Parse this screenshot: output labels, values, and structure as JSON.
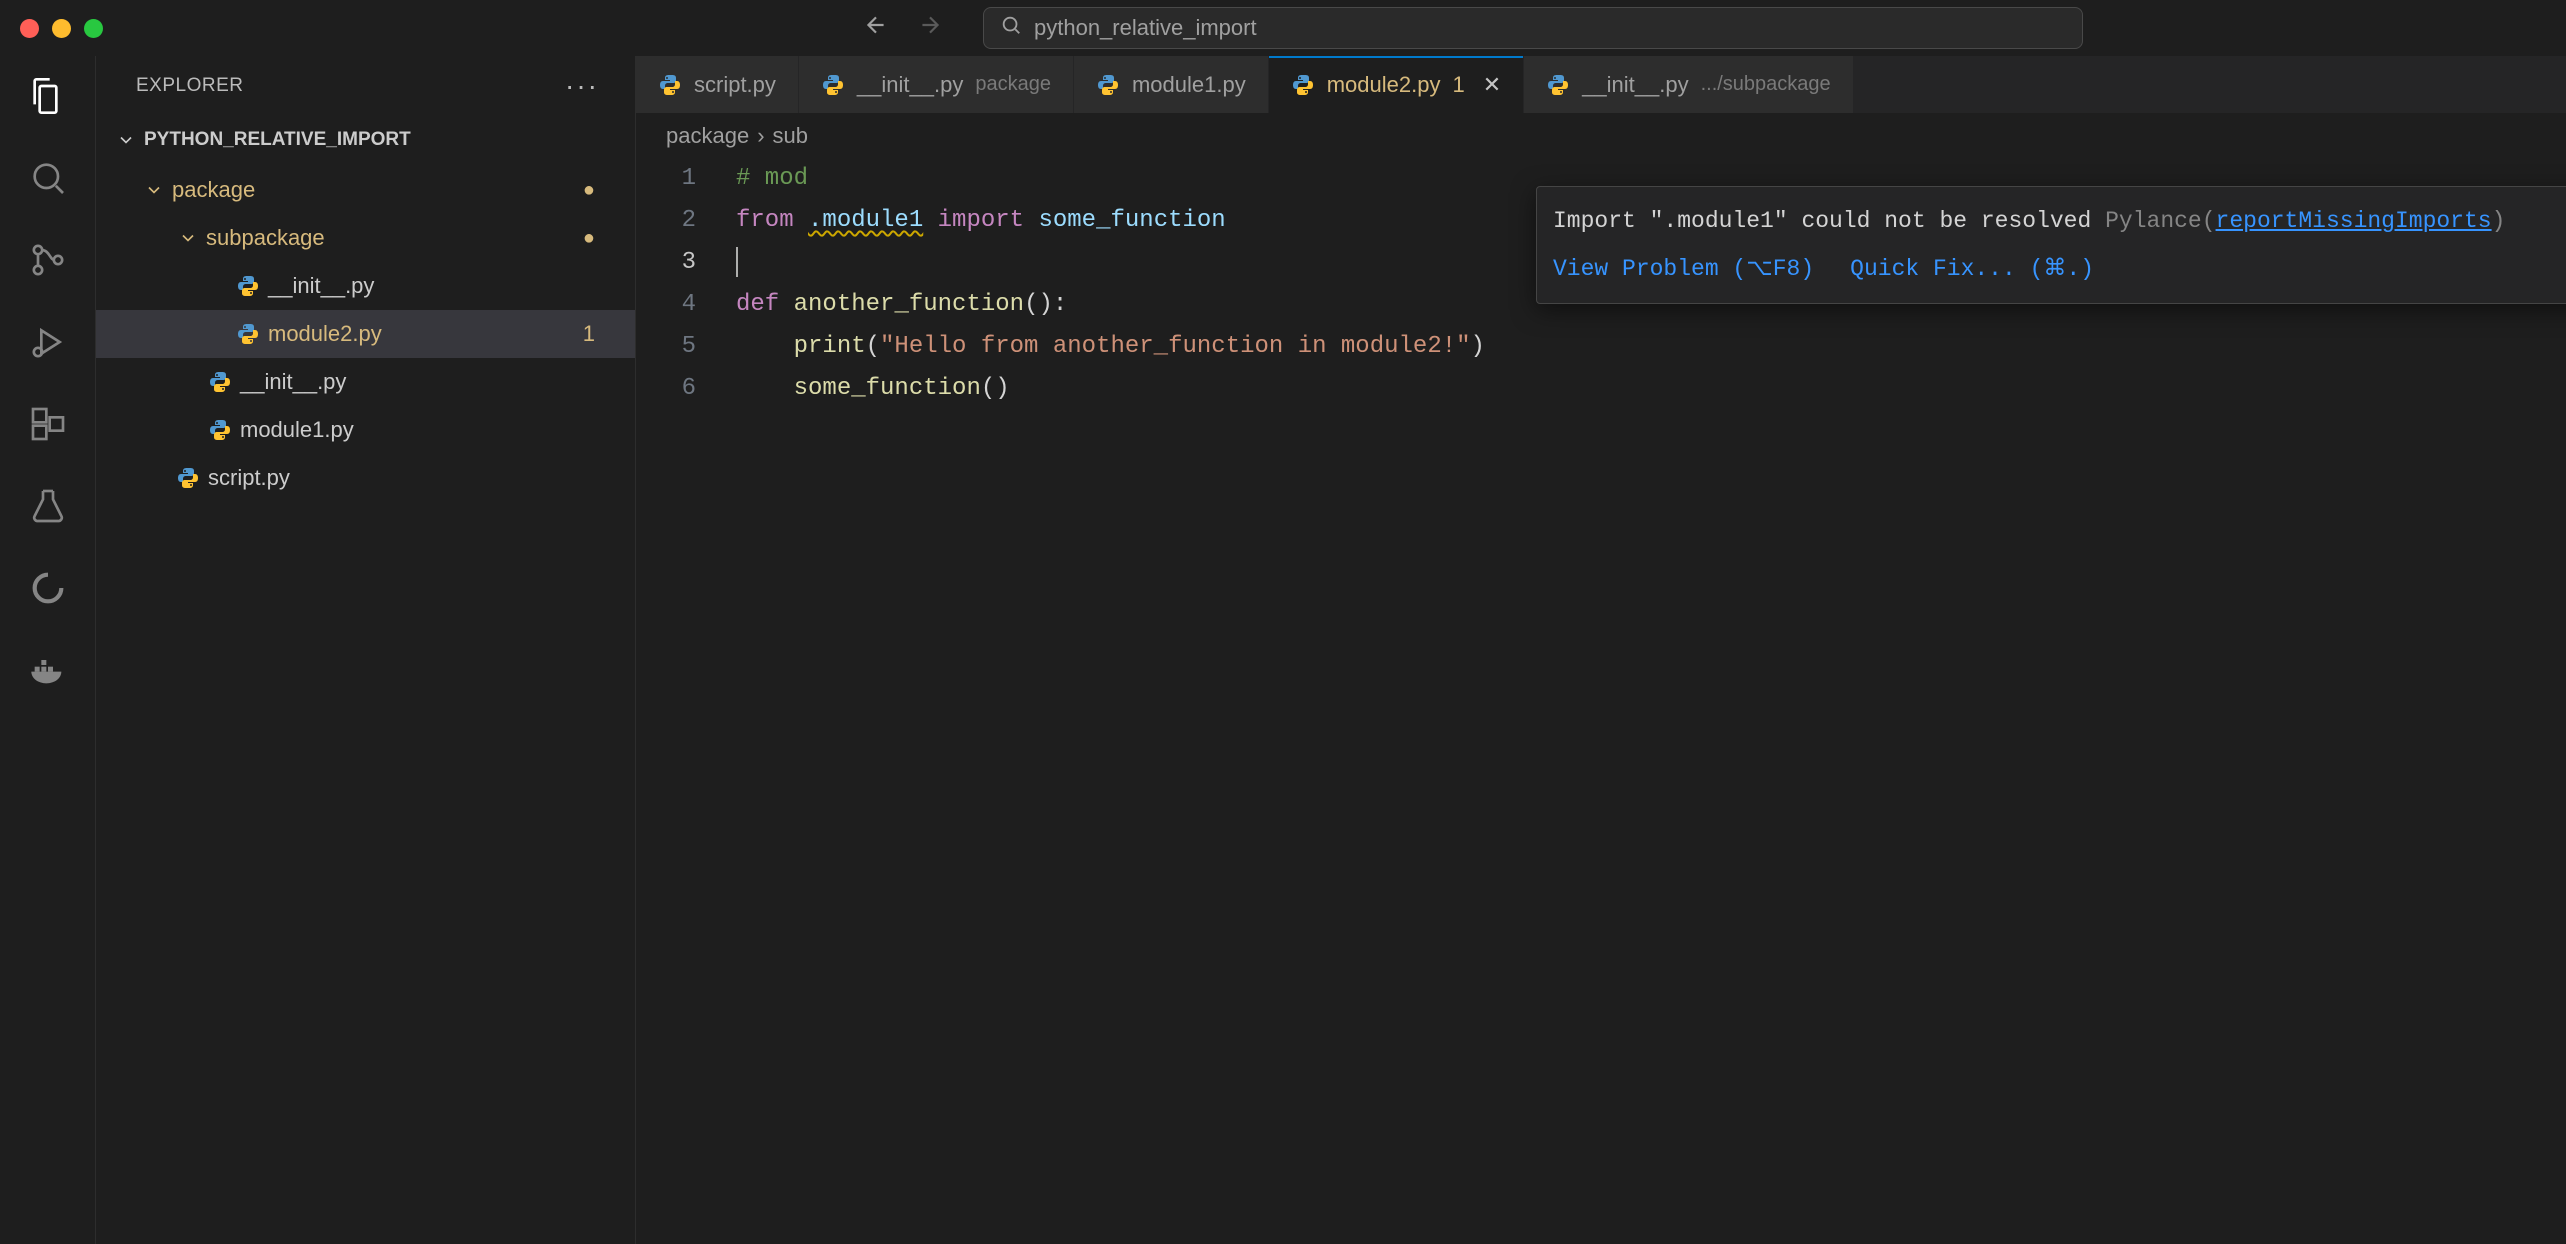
{
  "titlebar": {
    "search_text": "python_relative_import"
  },
  "sidebar": {
    "title": "EXPLORER",
    "project": "PYTHON_RELATIVE_IMPORT",
    "tree": {
      "package": "package",
      "subpackage": "subpackage",
      "init_sub": "__init__.py",
      "module2": "module2.py",
      "module2_badge": "1",
      "init_pkg": "__init__.py",
      "module1": "module1.py",
      "script": "script.py"
    }
  },
  "tabs": [
    {
      "name": "script.py",
      "suffix": "",
      "active": false
    },
    {
      "name": "__init__.py",
      "suffix": "package",
      "active": false
    },
    {
      "name": "module1.py",
      "suffix": "",
      "active": false
    },
    {
      "name": "module2.py",
      "suffix": "",
      "active": true,
      "badge": "1"
    },
    {
      "name": "__init__.py",
      "suffix": ".../subpackage",
      "active": false
    }
  ],
  "breadcrumb": {
    "part1": "package",
    "part2": "sub"
  },
  "code": {
    "lines": [
      "1",
      "2",
      "3",
      "4",
      "5",
      "6"
    ],
    "l1_comment": "# mod",
    "l2_from": "from",
    "l2_module": ".module1",
    "l2_import": "import",
    "l2_name": "some_function",
    "l4_def": "def",
    "l4_fn": "another_function",
    "l5_print": "print",
    "l5_str": "\"Hello from another_function in module2!\"",
    "l6_call": "some_function"
  },
  "tooltip": {
    "msg_pre": "Import \".module1\" could not be resolved",
    "src": "Pylance",
    "link": "reportMissingImports",
    "action1": "View Problem (⌥F8)",
    "action2": "Quick Fix... (⌘.)"
  }
}
